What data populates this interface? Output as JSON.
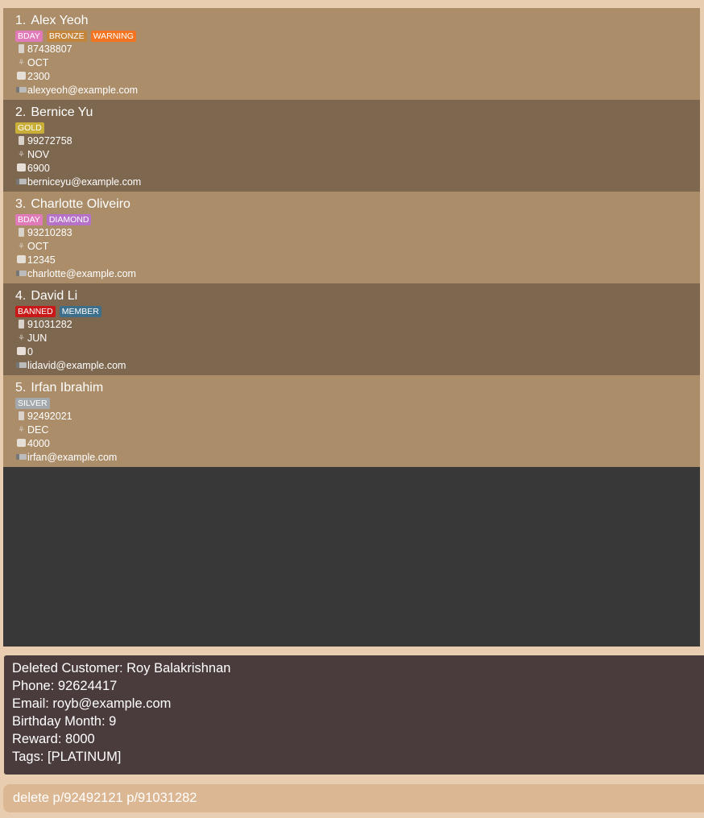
{
  "colors": {
    "background": "#e8cdb0",
    "card_odd": "#ab8d6a",
    "card_even": "#7e674f",
    "list_empty": "#383838",
    "result_box": "#4a3c3c",
    "command_box": "#dcb793",
    "tags": {
      "BDAY": "#e07ab8",
      "BRONZE": "#c2853b",
      "WARNING": "#f27420",
      "GOLD": "#c9ae38",
      "DIAMOND": "#b672c9",
      "BANNED": "#c81818",
      "MEMBER": "#3e6f8a",
      "SILVER": "#a3a8ad"
    }
  },
  "customers": [
    {
      "index": "1.",
      "name": "Alex Yeoh",
      "tags": [
        "BDAY",
        "BRONZE",
        "WARNING"
      ],
      "phone": "87438807",
      "birthday": "OCT",
      "reward": "2300",
      "email": "alexyeoh@example.com"
    },
    {
      "index": "2.",
      "name": "Bernice Yu",
      "tags": [
        "GOLD"
      ],
      "phone": "99272758",
      "birthday": "NOV",
      "reward": "6900",
      "email": "berniceyu@example.com"
    },
    {
      "index": "3.",
      "name": "Charlotte Oliveiro",
      "tags": [
        "BDAY",
        "DIAMOND"
      ],
      "phone": "93210283",
      "birthday": "OCT",
      "reward": "12345",
      "email": "charlotte@example.com"
    },
    {
      "index": "4.",
      "name": "David Li",
      "tags": [
        "BANNED",
        "MEMBER"
      ],
      "phone": "91031282",
      "birthday": "JUN",
      "reward": "0",
      "email": "lidavid@example.com"
    },
    {
      "index": "5.",
      "name": "Irfan Ibrahim",
      "tags": [
        "SILVER"
      ],
      "phone": "92492021",
      "birthday": "DEC",
      "reward": "4000",
      "email": "irfan@example.com"
    }
  ],
  "icons": {
    "phone": "phone-icon",
    "birthday": "cake-icon",
    "reward": "gift-icon",
    "email": "mail-icon"
  },
  "result": {
    "lines": [
      "Deleted Customer: Roy Balakrishnan",
      "Phone: 92624417",
      "Email: royb@example.com",
      "Birthday Month: 9",
      "Reward: 8000",
      "Tags: [PLATINUM]"
    ]
  },
  "command": {
    "value": "delete p/92492121 p/91031282"
  }
}
